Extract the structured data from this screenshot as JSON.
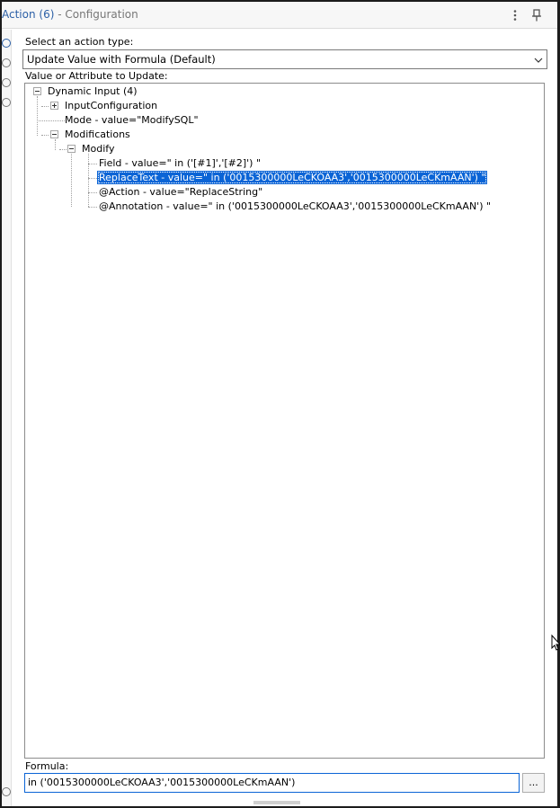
{
  "titlebar": {
    "title_main": "Action (6)",
    "title_sub": " - Configuration",
    "more_icon": "kebab-menu-icon",
    "pin_icon": "pin-icon"
  },
  "action_type": {
    "label": "Select an action type:",
    "selected": "Update Value with Formula (Default)"
  },
  "tree": {
    "label": "Value or Attribute to Update:",
    "root": "Dynamic Input (4)",
    "input_configuration": "InputConfiguration",
    "mode": "Mode - value=\"ModifySQL\"",
    "modifications": "Modifications",
    "modify": "Modify",
    "field": "Field - value=\" in  ('[#1]','[#2]') \"",
    "replace_text": "ReplaceText - value=\" in ('0015300000LeCKOAA3','0015300000LeCKmAAN') \"",
    "action": "@Action - value=\"ReplaceString\"",
    "annotation": "@Annotation - value=\" in ('0015300000LeCKOAA3','0015300000LeCKmAAN') \""
  },
  "formula": {
    "label": "Formula:",
    "value": "in ('0015300000LeCKOAA3','0015300000LeCKmAAN')",
    "button_label": "..."
  },
  "colors": {
    "selection": "#0a64d6",
    "title_accent": "#2b5fa6"
  }
}
